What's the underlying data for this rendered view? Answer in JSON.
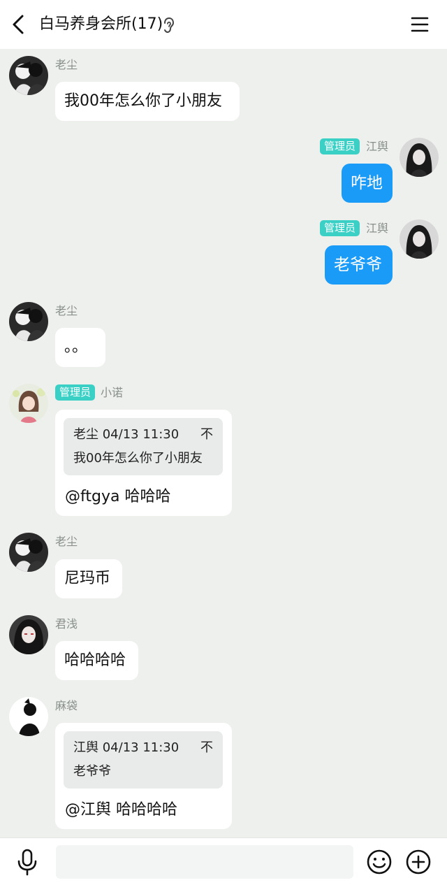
{
  "header": {
    "title": "白马养身会所(17)",
    "back_icon": "chevron-left-icon",
    "ear_icon": "ear-icon",
    "menu_icon": "hamburger-menu-icon"
  },
  "messages": [
    {
      "sender": "老尘",
      "text": "我00年怎么你了小朋友"
    },
    {
      "sender": "江舆",
      "badge": "管理员",
      "text": "咋地"
    },
    {
      "sender": "江舆",
      "badge": "管理员",
      "text": "老爷爷"
    },
    {
      "sender": "老尘",
      "text": "。。"
    },
    {
      "sender": "小诺",
      "badge": "管理员",
      "quote_header": "老尘 04/13 11:30",
      "quote_icon": "不",
      "quote_text": "我00年怎么你了小朋友",
      "text": "@ftgya 哈哈哈"
    },
    {
      "sender": "老尘",
      "text": "尼玛币"
    },
    {
      "sender": "君浅",
      "text": "哈哈哈哈"
    },
    {
      "sender": "麻袋",
      "quote_header": "江舆 04/13 11:30",
      "quote_icon": "不",
      "quote_text": "老爷爷",
      "text": "@江舆 哈哈哈哈"
    }
  ],
  "composer": {
    "placeholder": "",
    "mic_icon": "microphone-icon",
    "emoji_icon": "emoji-icon",
    "plus_icon": "plus-circle-icon"
  },
  "colors": {
    "background": "#edf0ed",
    "own_bubble": "#1a9bf7",
    "admin_tag": "#3bd0c6"
  }
}
